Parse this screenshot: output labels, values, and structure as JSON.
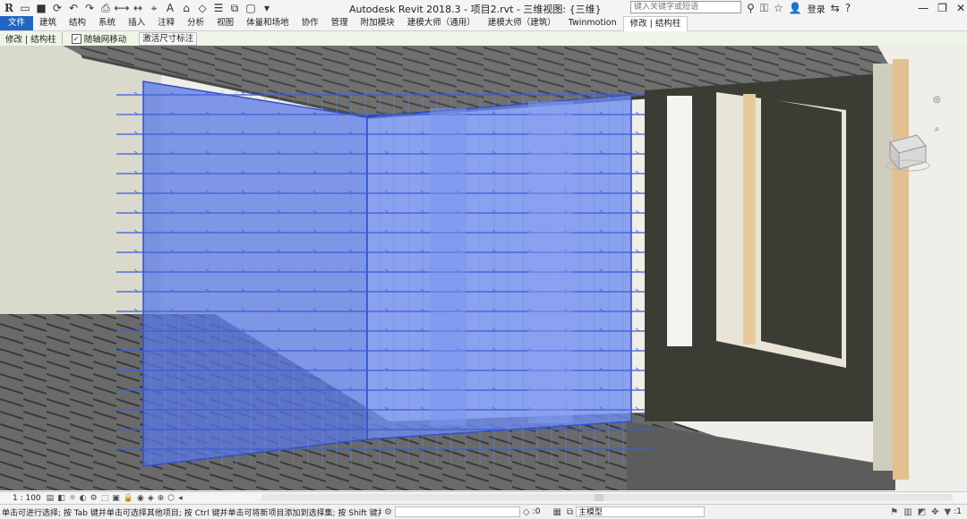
{
  "app": {
    "logo_letter": "R",
    "window_title": "Autodesk Revit 2018.3 -    项目2.rvt - 三维视图: {三维}",
    "login_label": "登录",
    "search_placeholder": "键入关键字或短语"
  },
  "qat_icons": [
    "open-icon",
    "save-icon",
    "sync-icon",
    "undo-icon",
    "redo-icon",
    "print-icon",
    "measure-icon",
    "dimension-icon",
    "tag-icon",
    "text-icon",
    "3d-view-icon",
    "section-icon",
    "thin-lines-icon",
    "close-views-icon",
    "switch-window-icon",
    "dropdown-icon"
  ],
  "menu": {
    "items": [
      "文件",
      "建筑",
      "结构",
      "系统",
      "插入",
      "注释",
      "分析",
      "视图",
      "体量和场地",
      "协作",
      "管理",
      "附加模块",
      "建模大师（通用）",
      "建模大师（建筑）",
      "Twinmotion",
      "修改 | 结构柱"
    ]
  },
  "options_bar": {
    "context_label": "修改 | 结构柱",
    "checkbox_label": "随轴网移动",
    "checkbox_checked": true,
    "button_label": "激活尺寸标注"
  },
  "view_control_bar": {
    "scale": "1 : 100"
  },
  "status_bar": {
    "message": "单击可进行选择; 按 Tab 键并单击可选择其他项目; 按 Ctrl 键并单击可将新项目添加到选择集; 按 Shift 键并单击可",
    "angle_value": ":0",
    "model_dropdown": "主模型",
    "filter_count": ":1"
  },
  "colors": {
    "file_tab": "#2266c4",
    "options_bar": "#eef5e6",
    "selection_blue": "#5a78e6",
    "slab_gray": "#5a5a5a",
    "wall_dark": "#3b3d35"
  }
}
